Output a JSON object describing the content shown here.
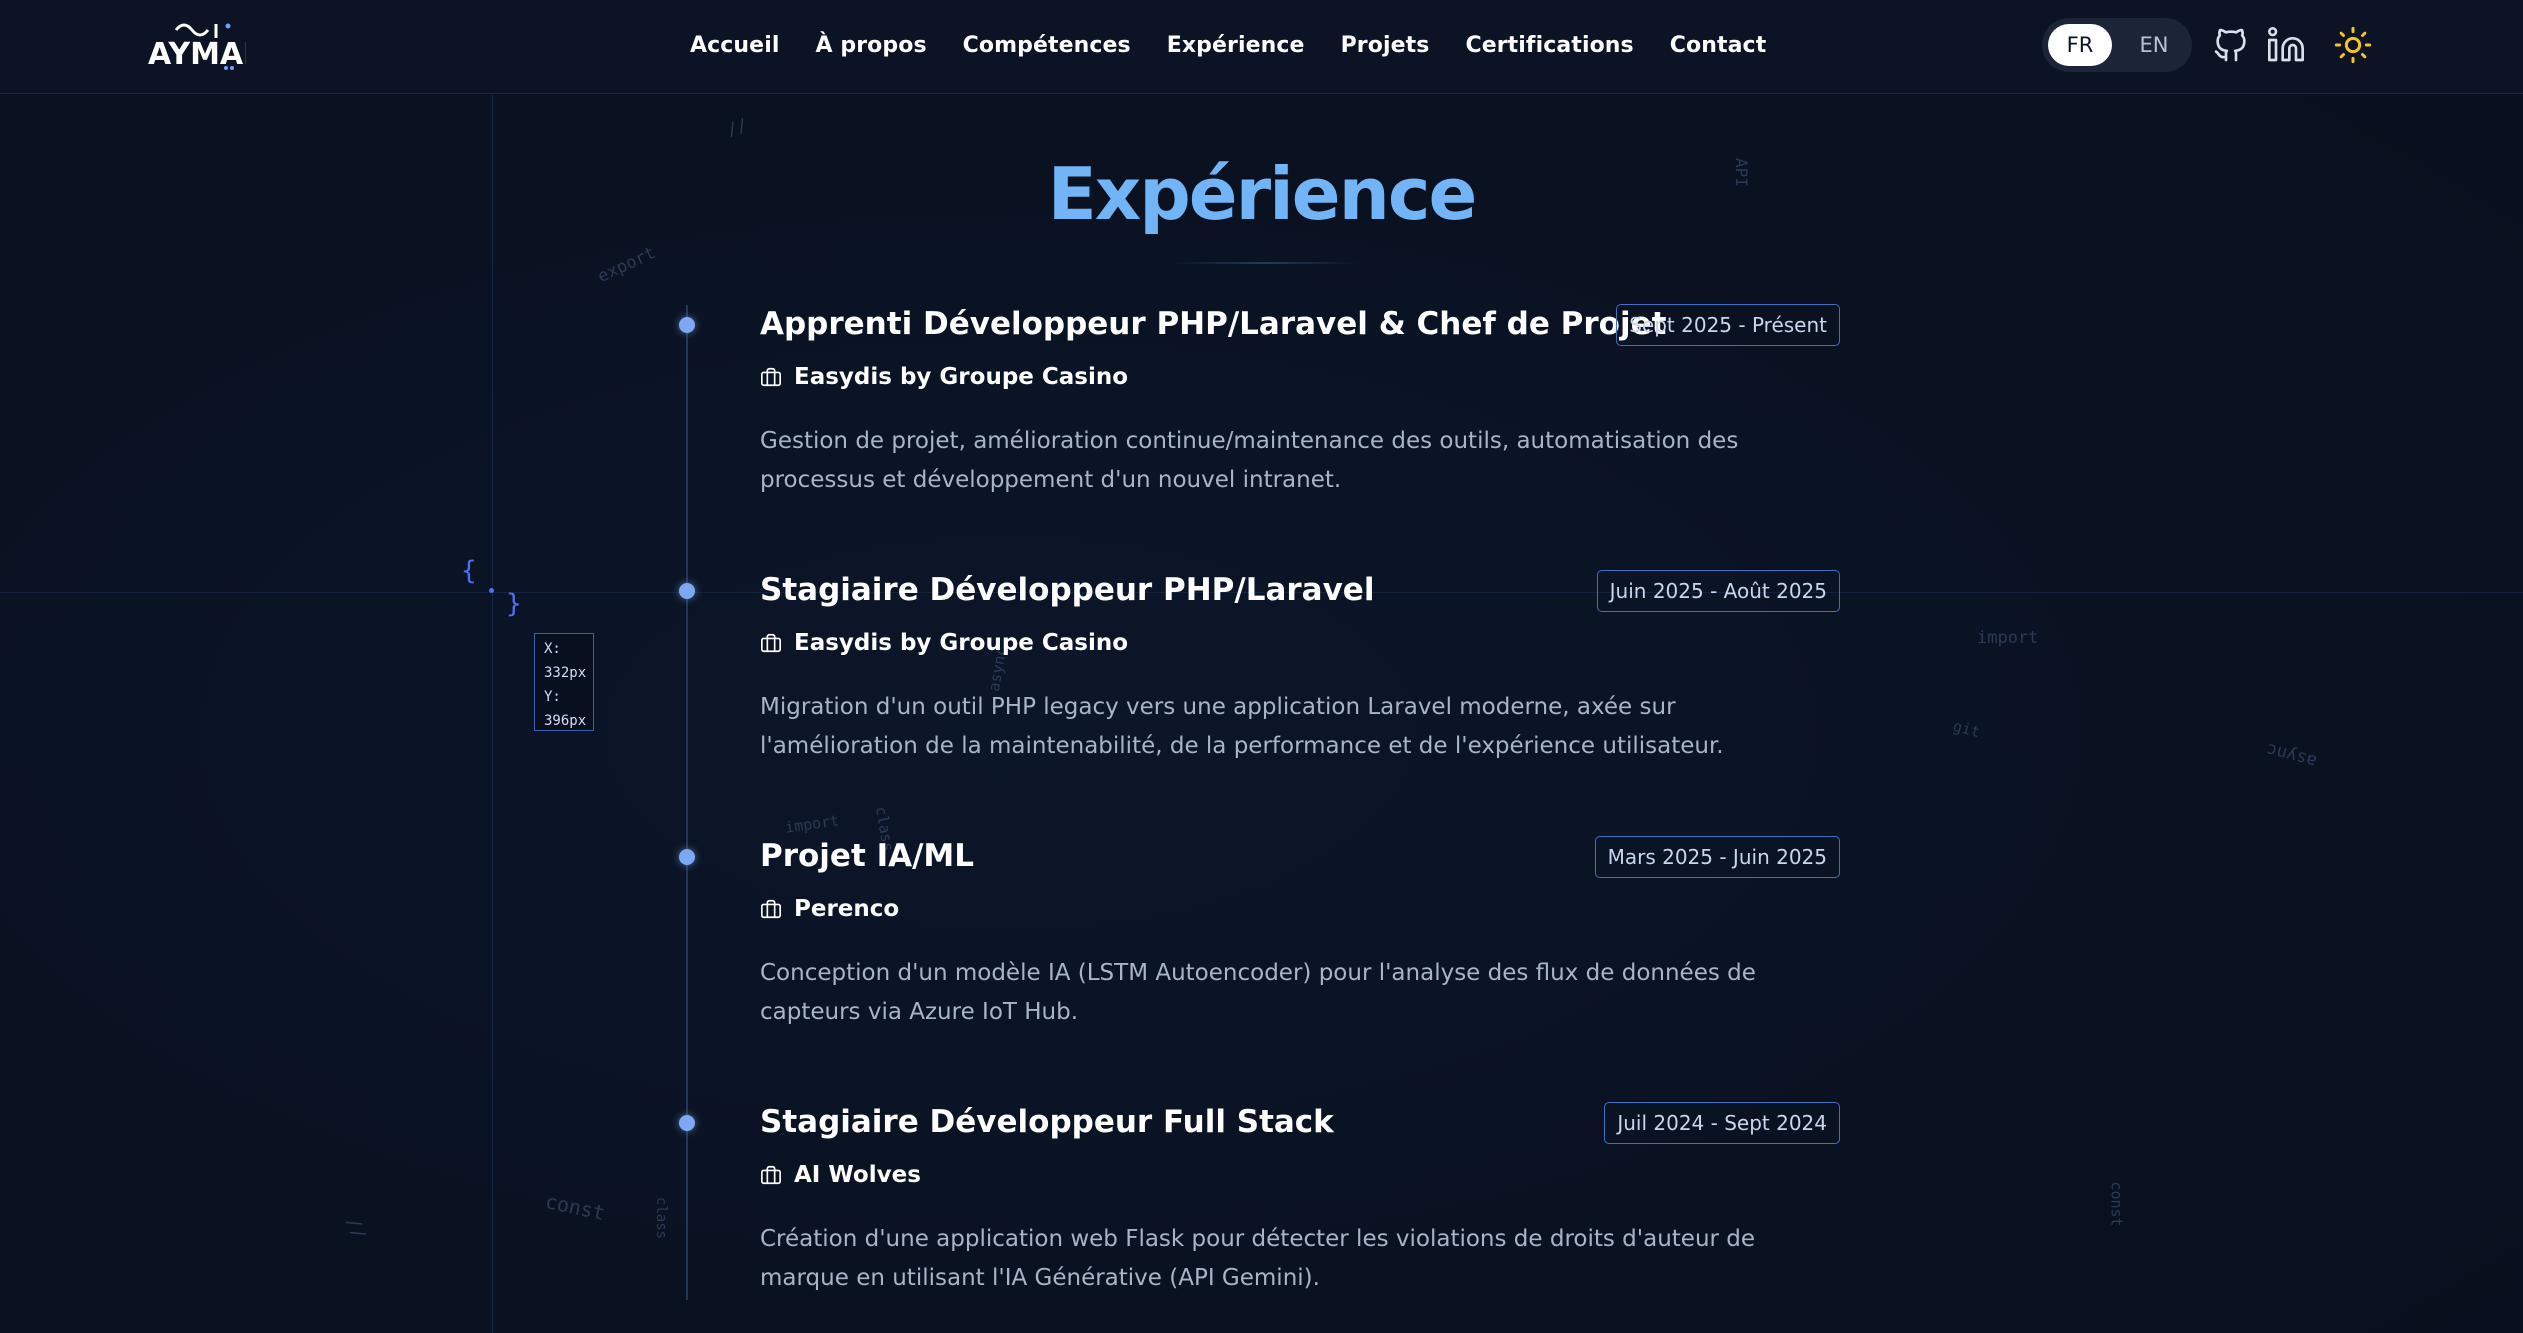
{
  "header": {
    "logo_text": "AYMAN",
    "nav": [
      "Accueil",
      "À propos",
      "Compétences",
      "Expérience",
      "Projets",
      "Certifications",
      "Contact"
    ],
    "lang": {
      "fr": "FR",
      "en": "EN",
      "active": "FR"
    },
    "icons": [
      "github-icon",
      "linkedin-icon",
      "sun-icon"
    ]
  },
  "section": {
    "title": "Expérience"
  },
  "experiences": [
    {
      "title": "Apprenti Développeur PHP/Laravel & Chef de Projet",
      "date": "Sept 2025 - Présent",
      "company": "Easydis by Groupe Casino",
      "description": "Gestion de projet, amélioration continue/maintenance des outils, automatisation des processus et développement d'un nouvel intranet."
    },
    {
      "title": "Stagiaire Développeur PHP/Laravel",
      "date": "Juin 2025 - Août 2025",
      "company": "Easydis by Groupe Casino",
      "description": "Migration d'un outil PHP legacy vers une application Laravel moderne, axée sur l'amélioration de la maintenabilité, de la performance et de l'expérience utilisateur."
    },
    {
      "title": "Projet IA/ML",
      "date": "Mars 2025 - Juin 2025",
      "company": "Perenco",
      "description": "Conception d'un modèle IA (LSTM Autoencoder) pour l'analyse des flux de données de capteurs via Azure IoT Hub."
    },
    {
      "title": "Stagiaire Développeur Full Stack",
      "date": "Juil 2024 - Sept 2024",
      "company": "AI Wolves",
      "description": "Création d'une application web Flask pour détecter les violations de droits d'auteur de marque en utilisant l'IA Générative (API Gemini)."
    }
  ],
  "cursor_readout": {
    "x_label": "X:",
    "x_value": "332px",
    "y_label": "Y:",
    "y_value": "396px"
  },
  "background_code_words": [
    "export",
    "import",
    "class",
    "async",
    "const",
    "git",
    "API",
    "//",
    "{",
    "}"
  ],
  "colors": {
    "accent": "#71b5f6",
    "background": "#0a1222",
    "dot": "#7ea8f4",
    "date_border": "#3f6fc0",
    "sun": "#f5c518"
  }
}
